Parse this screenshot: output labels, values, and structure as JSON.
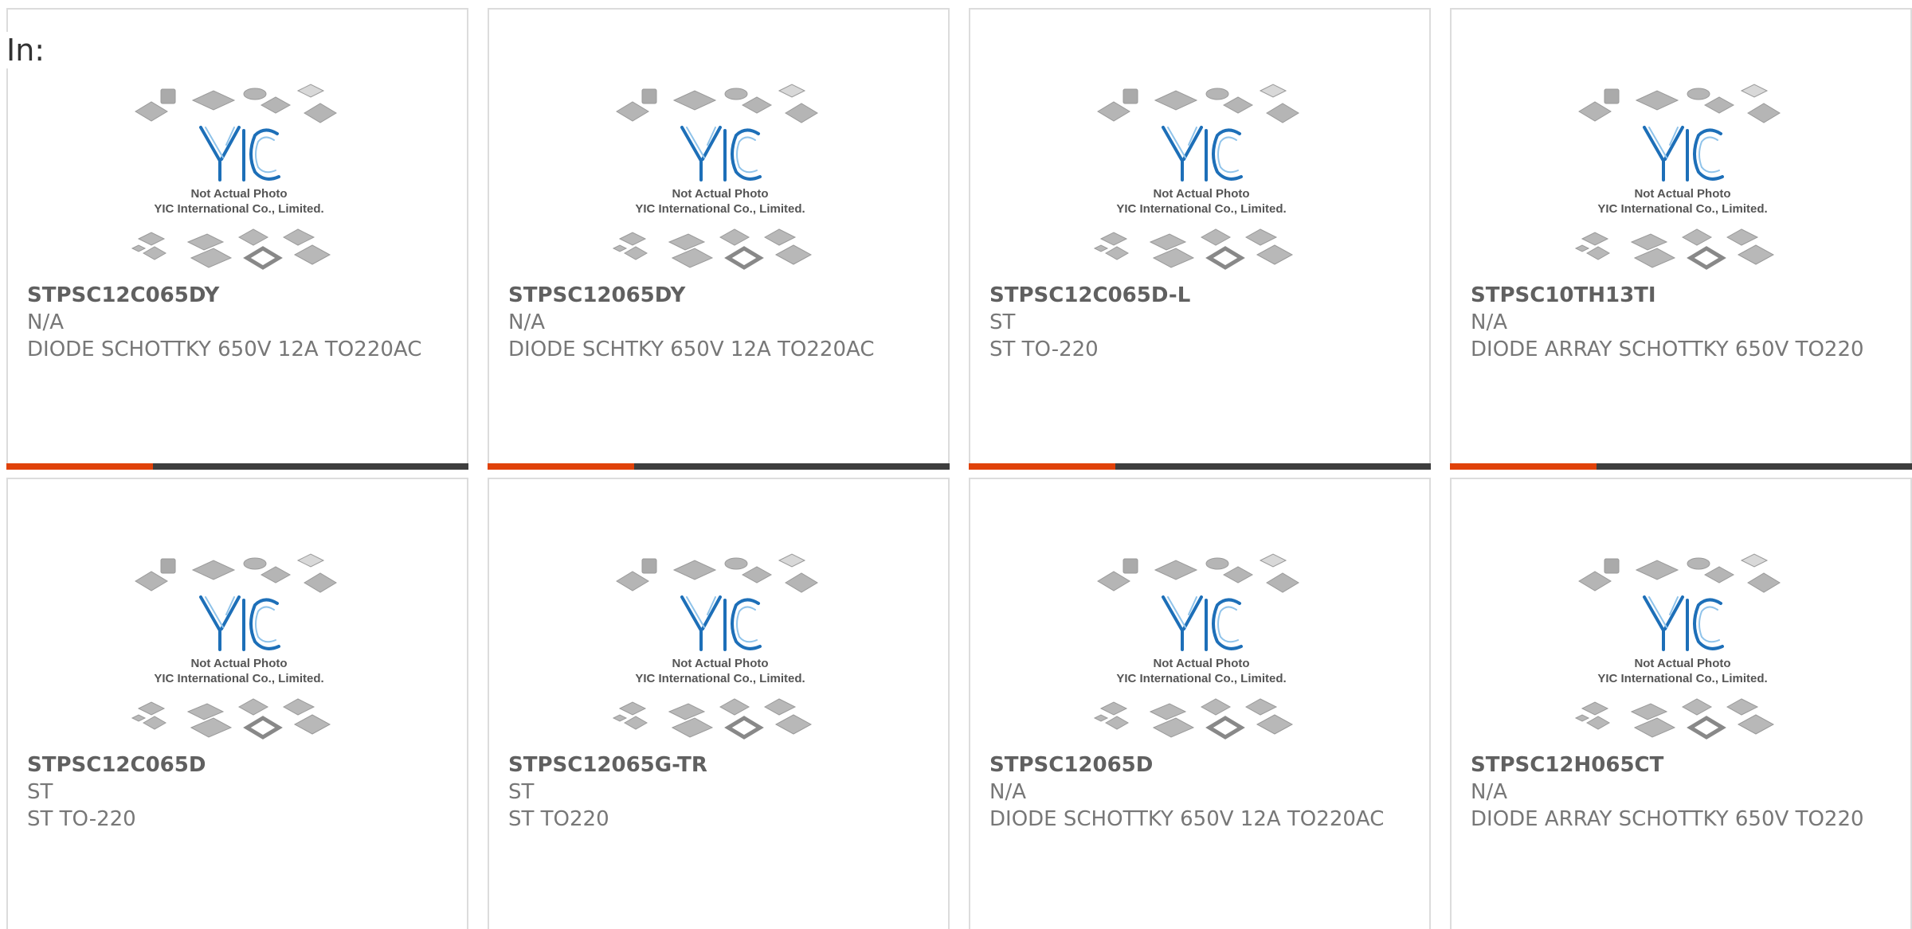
{
  "filter": {
    "label": "In:"
  },
  "placeholder_image": {
    "logo_text": "YIC",
    "line1": "Not Actual Photo",
    "line2": "YIC International Co., Limited.",
    "logo_color": "#1d6fb8"
  },
  "accent_color": "#e0420a",
  "products": [
    {
      "part": "STPSC12C065DY",
      "manufacturer": "N/A",
      "description": "DIODE SCHOTTKY 650V 12A TO220AC"
    },
    {
      "part": "STPSC12065DY",
      "manufacturer": "N/A",
      "description": "DIODE SCHTKY 650V 12A TO220AC"
    },
    {
      "part": "STPSC12C065D-L",
      "manufacturer": "ST",
      "description": "ST TO-220"
    },
    {
      "part": "STPSC10TH13TI",
      "manufacturer": "N/A",
      "description": "DIODE ARRAY SCHOTTKY 650V TO220"
    },
    {
      "part": "STPSC12C065D",
      "manufacturer": "ST",
      "description": "ST TO-220"
    },
    {
      "part": "STPSC12065G-TR",
      "manufacturer": "ST",
      "description": "ST TO220"
    },
    {
      "part": "STPSC12065D",
      "manufacturer": "N/A",
      "description": "DIODE SCHOTTKY 650V 12A TO220AC"
    },
    {
      "part": "STPSC12H065CT",
      "manufacturer": "N/A",
      "description": "DIODE ARRAY SCHOTTKY 650V TO220"
    }
  ]
}
